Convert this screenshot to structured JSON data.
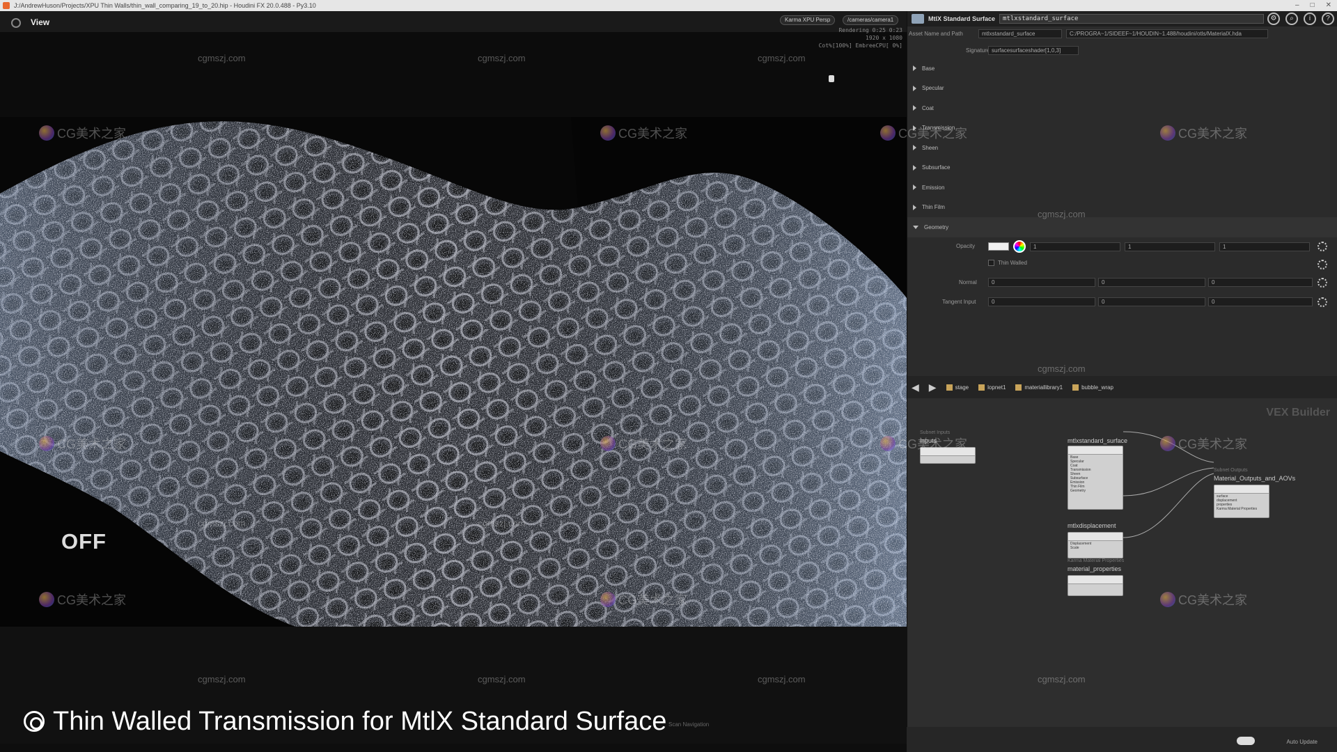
{
  "window": {
    "title": "J:/AndrewHuson/Projects/XPU Thin Walls/thin_wall_comparing_19_to_20.hip - Houdini FX 20.0.488 - Py3.10"
  },
  "viewport": {
    "label": "View",
    "renderer_menu": "Karma XPU Persp",
    "camera_menu": "/cameras/camera1",
    "stats": [
      "Rendering  0:25  0:23",
      "1920 x 1080",
      "Cot%[100%] EmbreeCPU[ 0%]"
    ],
    "overlay_text": "OFF"
  },
  "caption": {
    "text": "Thin Walled Transmission for MtlX Standard Surface",
    "nav_hint": "Scan Navigation"
  },
  "params": {
    "node_type": "MtlX Standard Surface",
    "node_name": "mtlxstandard_surface",
    "asset_label": "Asset Name and Path",
    "asset_name": "mtlxstandard_surface",
    "asset_path": "C:/PROGRA~1/SIDEEF~1/HOUDIN~1.488/houdini/otls/MaterialX.hda",
    "signature_label": "Signature",
    "signature_value": "surfacesurfaceshader[1,0,3]",
    "folders": [
      "Base",
      "Specular",
      "Coat",
      "Transmission",
      "Sheen",
      "Subsurface",
      "Emission",
      "Thin Film",
      "Geometry"
    ],
    "opacity_label": "Opacity",
    "opacity_values": [
      "1",
      "1",
      "1"
    ],
    "thin_walled_label": "Thin Walled",
    "normal_label": "Normal",
    "normal_values": [
      "0",
      "0",
      "0"
    ],
    "tangent_label": "Tangent Input",
    "tangent_values": [
      "0",
      "0",
      "0"
    ]
  },
  "network": {
    "path": [
      "stage",
      "lopnet1",
      "materiallibrary1",
      "bubble_wrap"
    ],
    "context_label": "VEX Builder",
    "inputs_small": "Subnet Inputs",
    "inputs_label": "inputs",
    "surface_label": "mtlxstandard_surface",
    "surface_ports": [
      "Base",
      "Specular",
      "Coat",
      "Transmission",
      "Sheen",
      "Subsurface",
      "Emission",
      "Thin Film",
      "Geometry"
    ],
    "displacement_label": "mtlxdisplacement",
    "displacement_ports": [
      "Displacement",
      "Scale"
    ],
    "matprop_small": "Karma Material Properties",
    "matprop_label": "material_properties",
    "output_small": "Subnet Outputs",
    "output_label": "Material_Outputs_and_AOVs",
    "output_ports": [
      "surface",
      "displacement",
      "properties",
      "Karma Material Properties"
    ]
  },
  "status": {
    "auto_update": "Auto Update"
  },
  "watermarks": {
    "text": "cgmszj.com",
    "logo_text": "CG美术之家"
  },
  "colors": {
    "accent": "#e8662c",
    "panel_bg": "#2b2b2b",
    "viewport_bg": "#0c0c0c"
  }
}
